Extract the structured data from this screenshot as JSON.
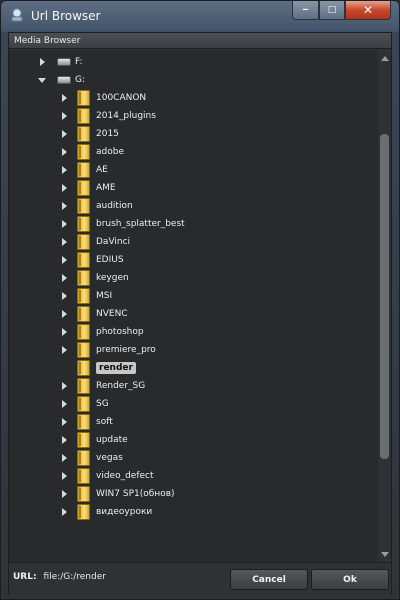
{
  "window": {
    "title": "Url Browser",
    "minimize_glyph": "‒",
    "maximize_glyph": "□",
    "close_glyph": "✕"
  },
  "panel": {
    "header": "Media Browser"
  },
  "tree": {
    "drives": [
      {
        "label": "F:",
        "expanded": false
      },
      {
        "label": "G:",
        "expanded": true
      }
    ],
    "folders": [
      {
        "label": "100CANON",
        "selected": false
      },
      {
        "label": "2014_plugins",
        "selected": false
      },
      {
        "label": "2015",
        "selected": false
      },
      {
        "label": "adobe",
        "selected": false
      },
      {
        "label": "AE",
        "selected": false
      },
      {
        "label": "AME",
        "selected": false
      },
      {
        "label": "audition",
        "selected": false
      },
      {
        "label": "brush_splatter_best",
        "selected": false
      },
      {
        "label": "DaVinci",
        "selected": false
      },
      {
        "label": "EDIUS",
        "selected": false
      },
      {
        "label": "keygen",
        "selected": false
      },
      {
        "label": "MSI",
        "selected": false
      },
      {
        "label": "NVENC",
        "selected": false
      },
      {
        "label": "photoshop",
        "selected": false
      },
      {
        "label": "premiere_pro",
        "selected": false
      },
      {
        "label": "render",
        "selected": true
      },
      {
        "label": "Render_SG",
        "selected": false
      },
      {
        "label": "SG",
        "selected": false
      },
      {
        "label": "soft",
        "selected": false
      },
      {
        "label": "update",
        "selected": false
      },
      {
        "label": "vegas",
        "selected": false
      },
      {
        "label": "video_defect",
        "selected": false
      },
      {
        "label": "WIN7 SP1(обнов)",
        "selected": false
      },
      {
        "label": "видеоуроки",
        "selected": false
      }
    ]
  },
  "url": {
    "label": "URL:",
    "value": "file:/G:/render"
  },
  "buttons": {
    "cancel": "Cancel",
    "ok": "Ok"
  },
  "colors": {
    "accent_folder": "#f2cf52",
    "selection_bg": "#c7c7c7",
    "close_button": "#c7482d"
  }
}
